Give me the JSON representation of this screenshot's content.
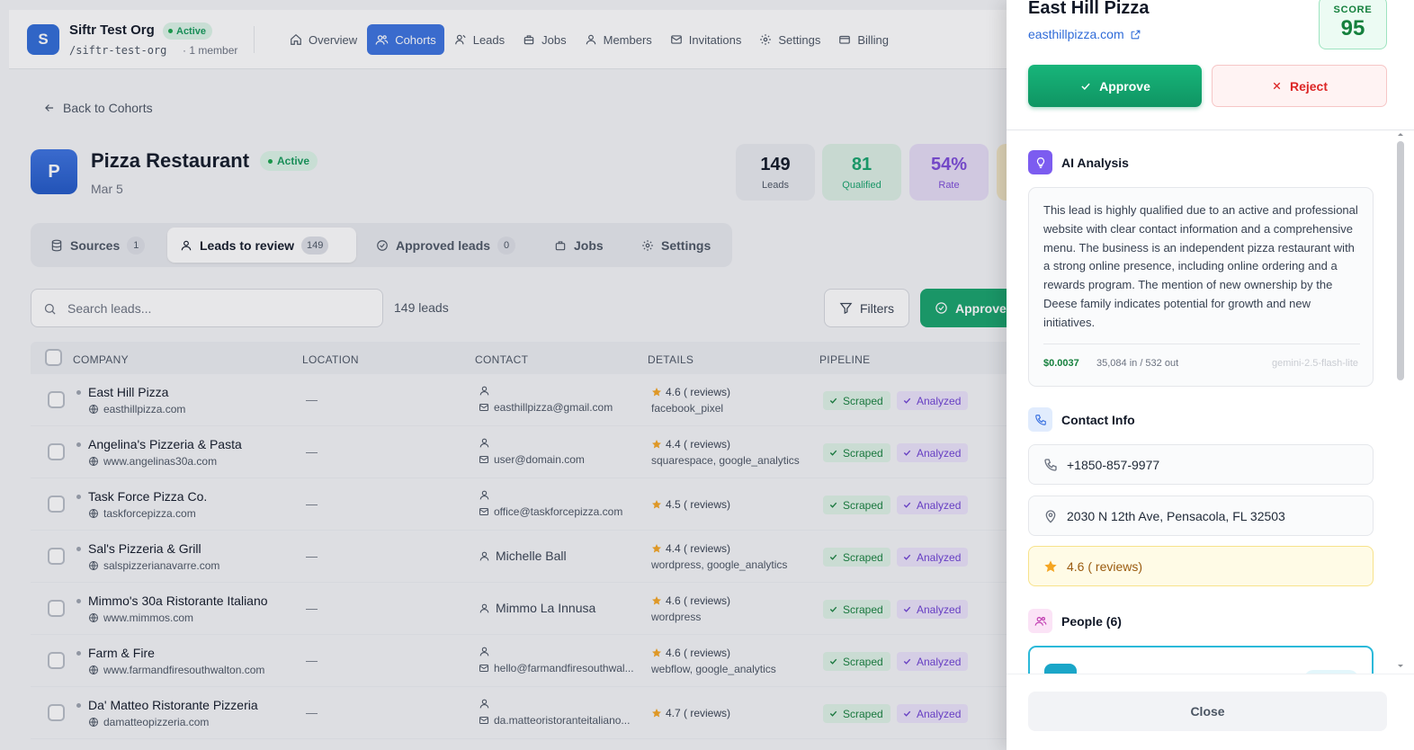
{
  "org": {
    "initial": "S",
    "name": "Siftr Test Org",
    "status": "Active",
    "slug": "/siftr-test-org",
    "members": "1 member"
  },
  "nav": [
    {
      "label": "Overview",
      "icon": "home-icon"
    },
    {
      "label": "Cohorts",
      "icon": "users-icon",
      "active": true
    },
    {
      "label": "Leads",
      "icon": "user-icon"
    },
    {
      "label": "Jobs",
      "icon": "briefcase-icon"
    },
    {
      "label": "Members",
      "icon": "users-icon"
    },
    {
      "label": "Invitations",
      "icon": "mail-icon"
    },
    {
      "label": "Settings",
      "icon": "gear-icon"
    },
    {
      "label": "Billing",
      "icon": "card-icon"
    }
  ],
  "back_label": "Back to Cohorts",
  "cohort": {
    "initial": "P",
    "title": "Pizza Restaurant",
    "status": "Active",
    "date": "Mar 5"
  },
  "stats": [
    {
      "value": "149",
      "label": "Leads"
    },
    {
      "value": "81",
      "label": "Qualified"
    },
    {
      "value": "54%",
      "label": "Rate"
    }
  ],
  "tabs": [
    {
      "label": "Sources",
      "count": "1"
    },
    {
      "label": "Leads to review",
      "count": "149",
      "active": true
    },
    {
      "label": "Approved leads",
      "count": "0"
    },
    {
      "label": "Jobs"
    },
    {
      "label": "Settings"
    }
  ],
  "search": {
    "placeholder": "Search leads..."
  },
  "lead_count": "149 leads",
  "filters_label": "Filters",
  "approve_all_label": "Approve",
  "table": {
    "columns": [
      "COMPANY",
      "LOCATION",
      "CONTACT",
      "DETAILS",
      "PIPELINE"
    ],
    "rows": [
      {
        "company": "East Hill Pizza",
        "site": "easthillpizza.com",
        "location": "—",
        "contact_name": "",
        "email": "easthillpizza@gmail.com",
        "rating": "4.6 ( reviews)",
        "tech": "facebook_pixel",
        "scraped": "Scraped",
        "analyzed": "Analyzed"
      },
      {
        "company": "Angelina's Pizzeria & Pasta",
        "site": "www.angelinas30a.com",
        "location": "—",
        "contact_name": "",
        "email": "user@domain.com",
        "rating": "4.4 ( reviews)",
        "tech": "squarespace, google_analytics",
        "scraped": "Scraped",
        "analyzed": "Analyzed"
      },
      {
        "company": "Task Force Pizza Co.",
        "site": "taskforcepizza.com",
        "location": "—",
        "contact_name": "",
        "email": "office@taskforcepizza.com",
        "rating": "4.5 ( reviews)",
        "tech": "",
        "scraped": "Scraped",
        "analyzed": "Analyzed"
      },
      {
        "company": "Sal's Pizzeria & Grill",
        "site": "salspizzerianavarre.com",
        "location": "—",
        "contact_name": "Michelle Ball",
        "email": "",
        "rating": "4.4 ( reviews)",
        "tech": "wordpress, google_analytics",
        "scraped": "Scraped",
        "analyzed": "Analyzed"
      },
      {
        "company": "Mimmo's 30a Ristorante Italiano",
        "site": "www.mimmos.com",
        "location": "—",
        "contact_name": "Mimmo La Innusa",
        "email": "",
        "rating": "4.6 ( reviews)",
        "tech": "wordpress",
        "scraped": "Scraped",
        "analyzed": "Analyzed"
      },
      {
        "company": "Farm & Fire",
        "site": "www.farmandfiresouthwalton.com",
        "location": "—",
        "contact_name": "",
        "email": "hello@farmandfiresouthwal...",
        "rating": "4.6 ( reviews)",
        "tech": "webflow, google_analytics",
        "scraped": "Scraped",
        "analyzed": "Analyzed"
      },
      {
        "company": "Da' Matteo Ristorante Pizzeria",
        "site": "damatteopizzeria.com",
        "location": "—",
        "contact_name": "",
        "email": "da.matteoristoranteitaliano...",
        "rating": "4.7 ( reviews)",
        "tech": "",
        "scraped": "Scraped",
        "analyzed": "Analyzed"
      }
    ]
  },
  "drawer": {
    "title": "East Hill Pizza",
    "website": "easthillpizza.com",
    "score_label": "SCORE",
    "score": "95",
    "approve_label": "Approve",
    "reject_label": "Reject",
    "ai": {
      "heading": "AI Analysis",
      "text": "This lead is highly qualified due to an active and professional website with clear contact information and a comprehensive menu. The business is an independent pizza restaurant with a strong online presence, including online ordering and a rewards program. The mention of new ownership by the Deese family indicates potential for growth and new initiatives.",
      "cost": "$0.0037",
      "tokens": "35,084 in / 532 out",
      "model": "gemini-2.5-flash-lite"
    },
    "contact": {
      "heading": "Contact Info",
      "phone": "+1850-857-9977",
      "address": "2030 N 12th Ave, Pensacola, FL 32503",
      "rating": "4.6 ( reviews)"
    },
    "people_heading": "People (6)",
    "close_label": "Close"
  },
  "colors": {
    "primary": "#3b72e0",
    "success": "#16a36c",
    "danger": "#dc2626",
    "ai_purple": "#7c5cf0"
  }
}
